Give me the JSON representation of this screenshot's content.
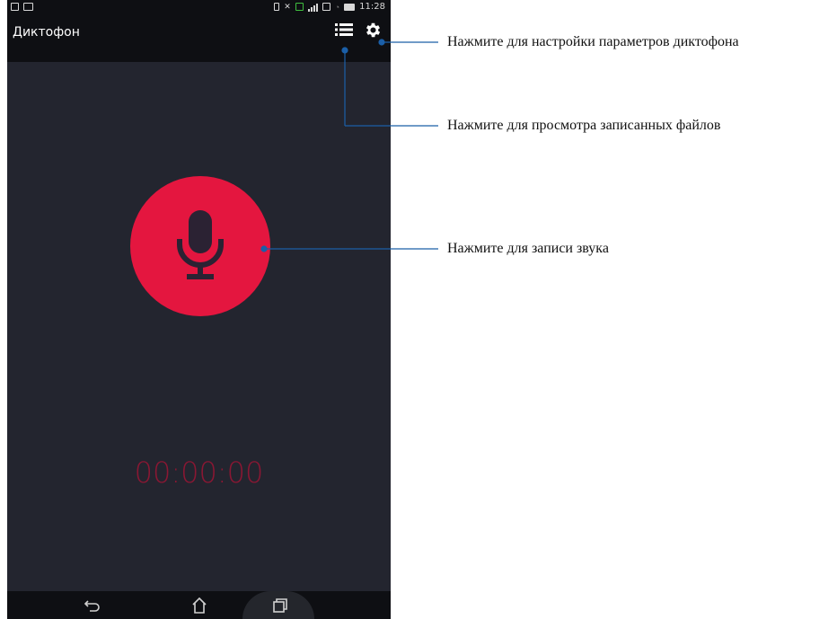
{
  "status_bar": {
    "time": "11:28",
    "left_icons": [
      "calendar-icon",
      "image-icon"
    ],
    "right_icons": [
      "vibrate-icon",
      "no-sound-icon",
      "sim-icon",
      "signal-icon",
      "sim2-icon",
      "wifi-icon",
      "battery-icon"
    ]
  },
  "app": {
    "title": "Диктофон",
    "list_icon": "list-icon",
    "settings_icon": "gear-icon"
  },
  "record": {
    "icon": "microphone-icon",
    "timer": "00:00:00"
  },
  "nav": {
    "back_icon": "back-icon",
    "home_icon": "home-icon",
    "recents_icon": "recents-icon"
  },
  "callouts": {
    "settings": "Нажмите для настройки параметров диктофона",
    "files": "Нажмите для просмотра записанных файлов",
    "record": "Нажмите для записи звука"
  },
  "colors": {
    "background": "#23252f",
    "bar": "#0e0f13",
    "record_red": "#e4163f",
    "timer": "#8a1733",
    "callout_line": "#1b5fa8"
  }
}
